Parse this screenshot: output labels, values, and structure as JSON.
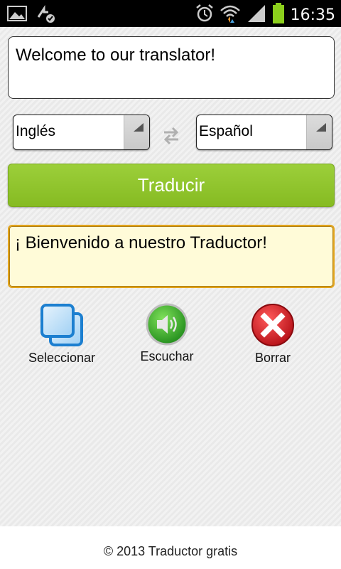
{
  "statusbar": {
    "time": "16:35",
    "icons": [
      "image-icon",
      "sync-icon",
      "alarm-icon",
      "wifi-icon",
      "signal-icon",
      "battery-icon"
    ]
  },
  "input": {
    "text": "Welcome to our translator!"
  },
  "source_language": {
    "selected": "Inglés"
  },
  "target_language": {
    "selected": "Español"
  },
  "translate_button": {
    "label": "Traducir"
  },
  "output": {
    "text": "¡ Bienvenido a nuestro Traductor!"
  },
  "actions": {
    "select": {
      "label": "Seleccionar",
      "icon": "copy-icon"
    },
    "listen": {
      "label": "Escuchar",
      "icon": "speaker-icon"
    },
    "clear": {
      "label": "Borrar",
      "icon": "close-icon"
    }
  },
  "footer": {
    "text": "© 2013 Traductor gratis"
  },
  "colors": {
    "accent_green": "#8cc42c",
    "output_border": "#e2a41c",
    "output_bg": "#fffbd8",
    "battery_green": "#8ccf1c",
    "clear_red": "#d9161d"
  }
}
